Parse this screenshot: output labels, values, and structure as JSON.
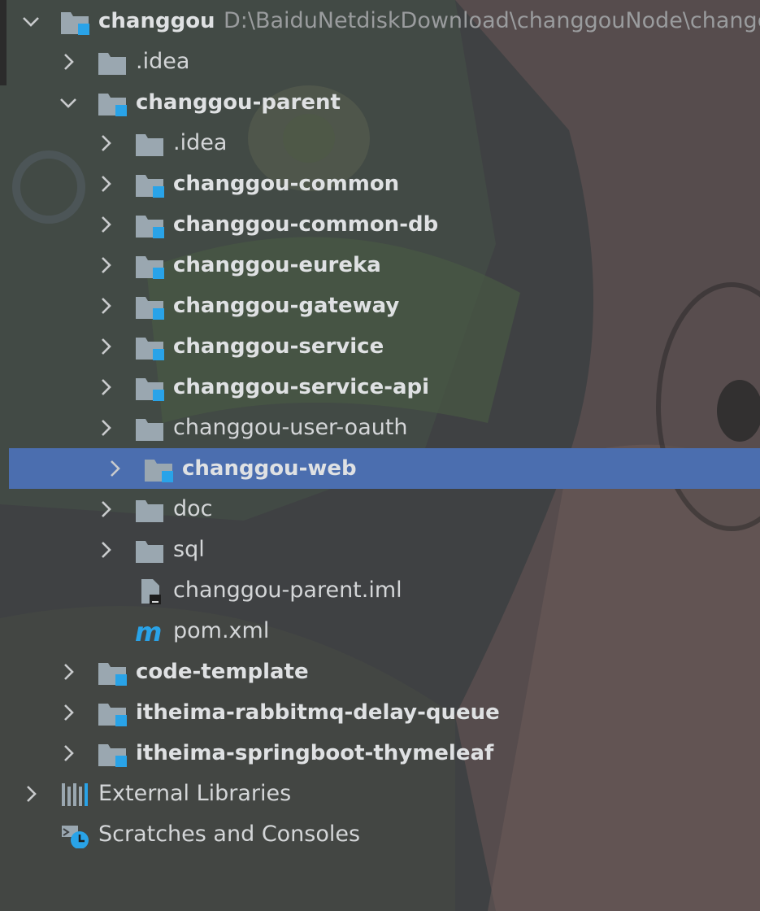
{
  "colors": {
    "selection": "#4b6eaf",
    "module_badge": "#29a3e8",
    "folder": "#9aa7b0",
    "text": "#d4d6d8"
  },
  "tree": {
    "root": {
      "label": "changgou",
      "path": "D:\\BaiduNetdiskDownload\\changgouNode\\changg",
      "icon": "module-folder-icon"
    },
    "rows": [
      {
        "label": ".idea",
        "icon": "folder-icon",
        "bold": false,
        "expanded": false
      },
      {
        "label": "changgou-parent",
        "icon": "module-folder-icon",
        "bold": true,
        "expanded": true
      },
      {
        "label": ".idea",
        "icon": "folder-icon",
        "bold": false,
        "expanded": false
      },
      {
        "label": "changgou-common",
        "icon": "module-folder-icon",
        "bold": true,
        "expanded": false
      },
      {
        "label": "changgou-common-db",
        "icon": "module-folder-icon",
        "bold": true,
        "expanded": false
      },
      {
        "label": "changgou-eureka",
        "icon": "module-folder-icon",
        "bold": true,
        "expanded": false
      },
      {
        "label": "changgou-gateway",
        "icon": "module-folder-icon",
        "bold": true,
        "expanded": false
      },
      {
        "label": "changgou-service",
        "icon": "module-folder-icon",
        "bold": true,
        "expanded": false
      },
      {
        "label": "changgou-service-api",
        "icon": "module-folder-icon",
        "bold": true,
        "expanded": false
      },
      {
        "label": "changgou-user-oauth",
        "icon": "folder-icon",
        "bold": false,
        "expanded": false
      },
      {
        "label": "changgou-web",
        "icon": "module-folder-icon",
        "bold": true,
        "expanded": false,
        "selected": true
      },
      {
        "label": "doc",
        "icon": "folder-icon",
        "bold": false,
        "expanded": false
      },
      {
        "label": "sql",
        "icon": "folder-icon",
        "bold": false,
        "expanded": false
      },
      {
        "label": "changgou-parent.iml",
        "icon": "iml-file-icon",
        "bold": false
      },
      {
        "label": "pom.xml",
        "icon": "maven-m-icon",
        "bold": false
      },
      {
        "label": "code-template",
        "icon": "module-folder-icon",
        "bold": true,
        "expanded": false
      },
      {
        "label": "itheima-rabbitmq-delay-queue",
        "icon": "module-folder-icon",
        "bold": true,
        "expanded": false
      },
      {
        "label": "itheima-springboot-thymeleaf",
        "icon": "module-folder-icon",
        "bold": true,
        "expanded": false
      },
      {
        "label": "External Libraries",
        "icon": "libraries-icon",
        "bold": false,
        "expanded": false
      },
      {
        "label": "Scratches and Consoles",
        "icon": "scratches-icon",
        "bold": false
      }
    ]
  }
}
